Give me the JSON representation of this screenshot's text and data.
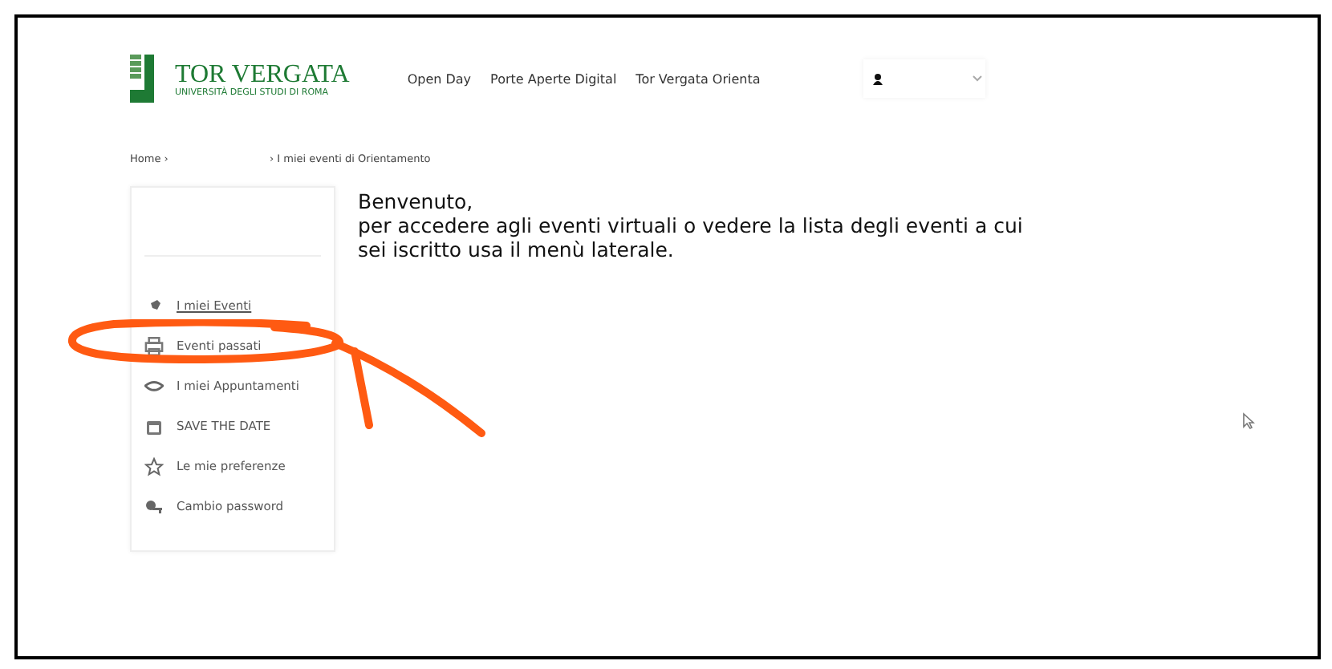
{
  "header": {
    "logo": {
      "title": "TOR VERGATA",
      "subtitle": "UNIVERSITÀ DEGLI STUDI DI ROMA"
    },
    "nav": [
      "Open Day",
      "Porte Aperte Digital",
      "Tor Vergata Orienta"
    ]
  },
  "breadcrumb": [
    "Home ›",
    "› I miei eventi di Orientamento"
  ],
  "sidebar": {
    "items": [
      {
        "label": "I miei Eventi"
      },
      {
        "label": "Eventi passati"
      },
      {
        "label": "I miei Appuntamenti"
      },
      {
        "label": "SAVE THE DATE"
      },
      {
        "label": "Le mie preferenze"
      },
      {
        "label": "Cambio password"
      }
    ]
  },
  "welcome": {
    "title": "Benvenuto,",
    "text": "per accedere agli eventi virtuali o vedere la lista degli eventi a cui sei iscritto usa il menù laterale."
  }
}
